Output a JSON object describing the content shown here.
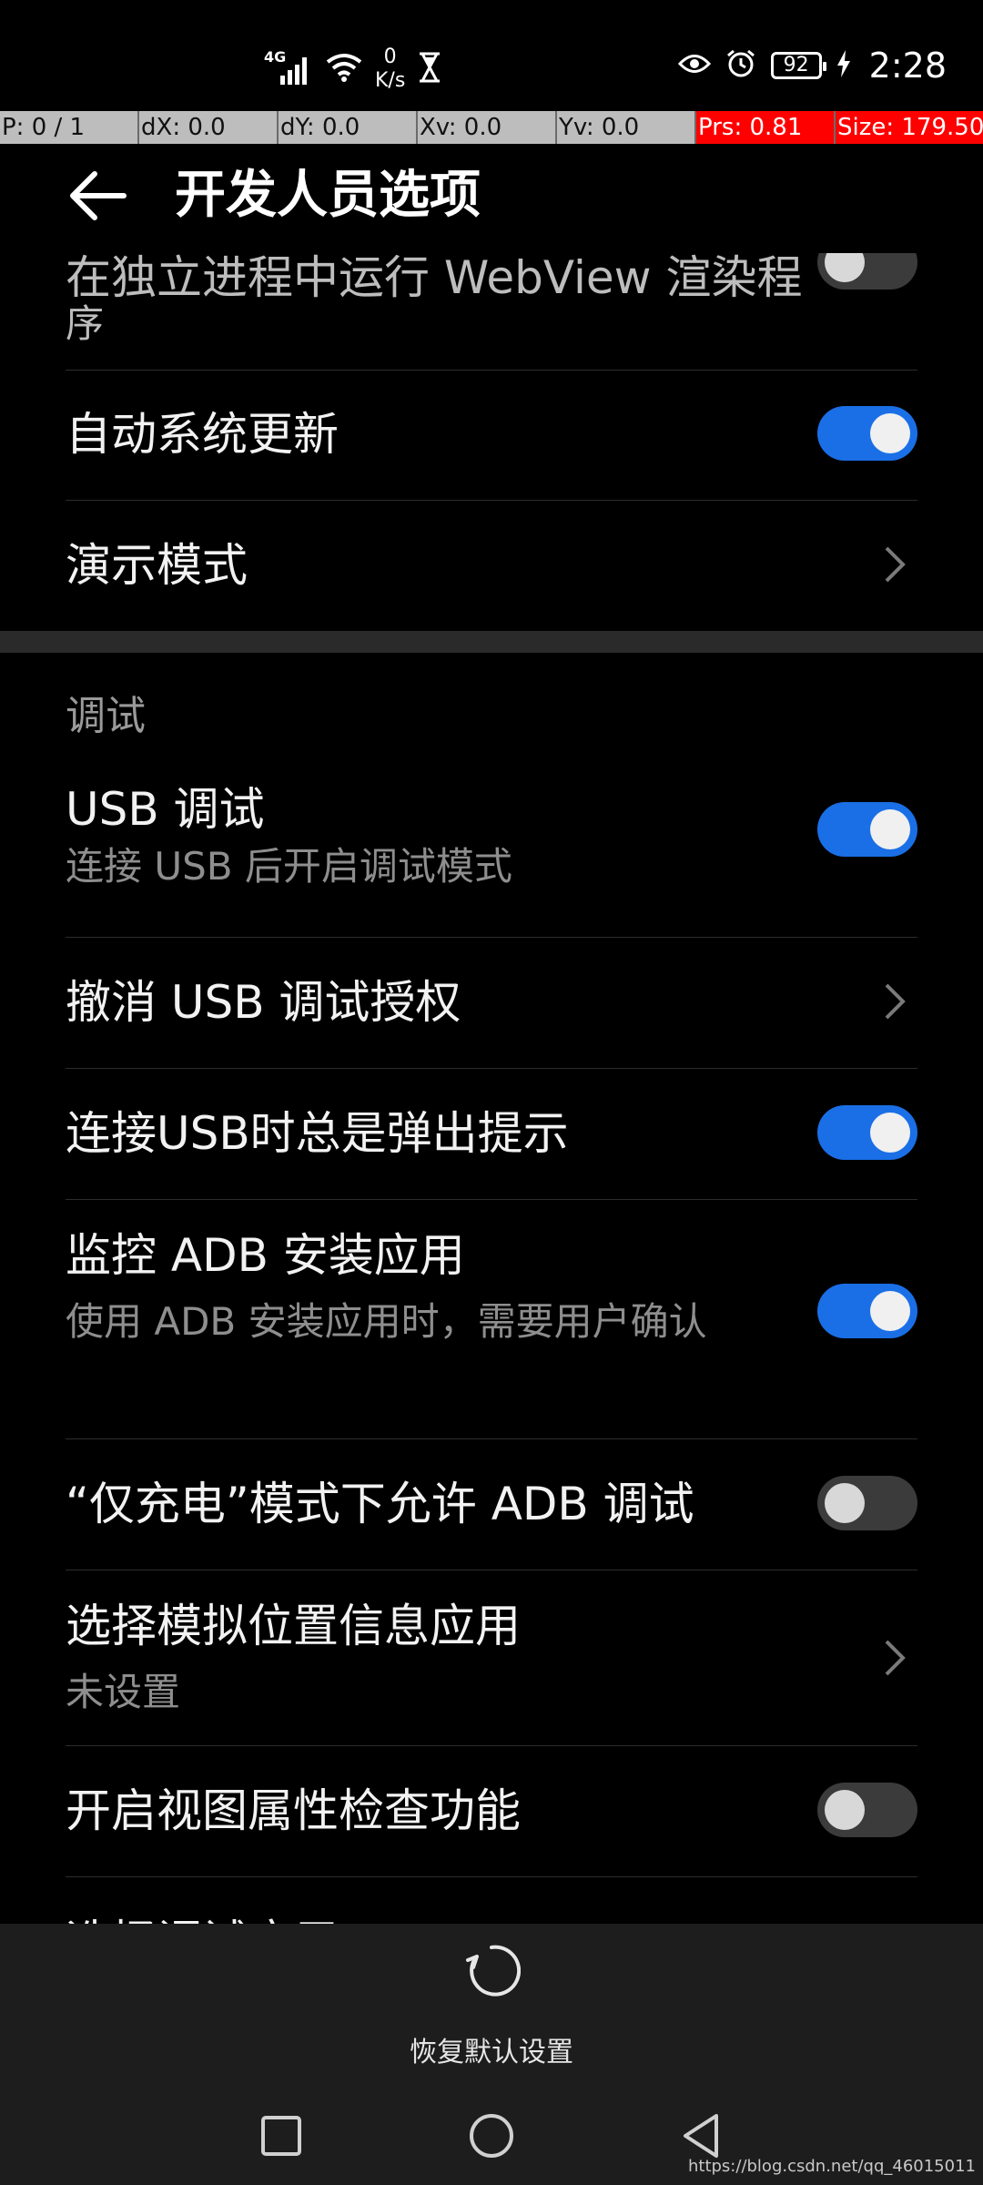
{
  "status_bar": {
    "network": "4G",
    "speed_value": "0",
    "speed_unit": "K/s",
    "battery": "92",
    "time": "2:28"
  },
  "pointer_bar": [
    "P: 0 / 1",
    "dX: 0.0",
    "dY: 0.0",
    "Xv: 0.0",
    "Yv: 0.0",
    "Prs: 0.81",
    "Size: 179.50"
  ],
  "app_bar": {
    "title": "开发人员选项"
  },
  "items": {
    "webview": {
      "title": "在独立进程中运行 WebView 渲染程",
      "cont": "序",
      "toggle": "off"
    },
    "auto_update": {
      "title": "自动系统更新",
      "toggle": "on"
    },
    "demo_mode": {
      "title": "演示模式"
    },
    "section_debug": "调试",
    "usb_debug": {
      "title": "USB 调试",
      "subtitle": "连接 USB 后开启调试模式",
      "toggle": "on"
    },
    "revoke_usb": {
      "title": "撤消 USB 调试授权"
    },
    "usb_prompt": {
      "title": "连接USB时总是弹出提示",
      "toggle": "on"
    },
    "adb_monitor": {
      "title": "监控 ADB 安装应用",
      "subtitle": "使用 ADB 安装应用时，需要用户确认",
      "toggle": "on"
    },
    "charge_only_adb": {
      "title": "“仅充电”模式下允许 ADB 调试",
      "toggle": "off"
    },
    "mock_location": {
      "title": "选择模拟位置信息应用",
      "subtitle": "未设置"
    },
    "view_attr": {
      "title": "开启视图属性检查功能",
      "toggle": "off"
    },
    "next_partial": {
      "title": "选择调试应用"
    }
  },
  "bottom": {
    "restore_label": "恢复默认设置"
  },
  "watermark": "https://blog.csdn.net/qq_46015011",
  "colors": {
    "accent": "#1a6fe6",
    "background": "#000000",
    "pointer_red": "#ff0000"
  }
}
